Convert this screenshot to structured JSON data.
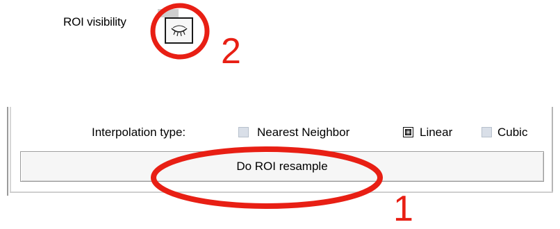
{
  "roi": {
    "label": "ROI visibility",
    "toggle_icon": "eye-closed-icon"
  },
  "interpolation": {
    "label": "Interpolation type:",
    "options": [
      {
        "label": "Nearest Neighbor",
        "checked": false
      },
      {
        "label": "Linear",
        "checked": true
      },
      {
        "label": "Cubic",
        "checked": false
      }
    ]
  },
  "resample_button": {
    "label": "Do ROI resample"
  },
  "annotations": {
    "marker_1": "1",
    "marker_2": "2",
    "color": "#e81f14"
  }
}
